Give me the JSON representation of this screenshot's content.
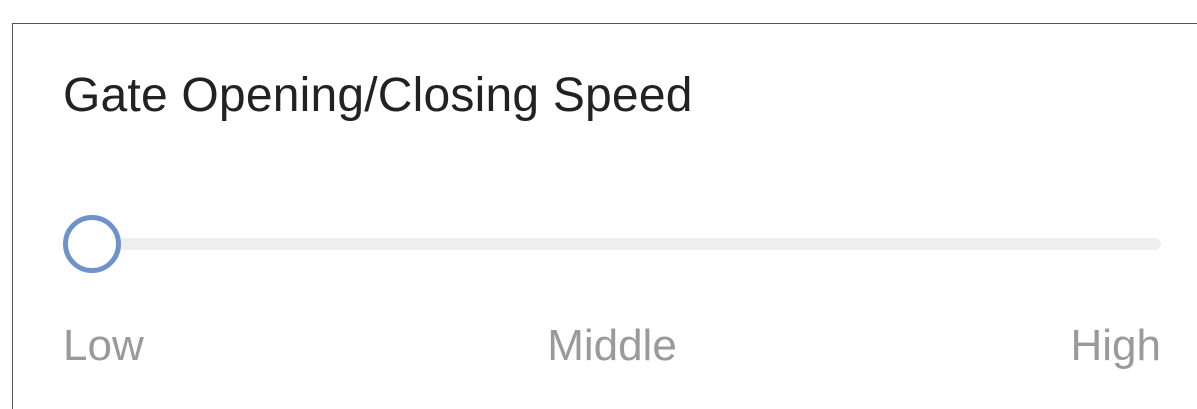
{
  "setting": {
    "title": "Gate Opening/Closing Speed",
    "slider": {
      "value_fraction": 0.0,
      "options": [
        "Low",
        "Middle",
        "High"
      ],
      "selected": "Low"
    }
  },
  "colors": {
    "accent": "#6f92cf",
    "track": "#eeeeee",
    "title_text": "#222222",
    "tick_text": "#9a9a9a"
  }
}
